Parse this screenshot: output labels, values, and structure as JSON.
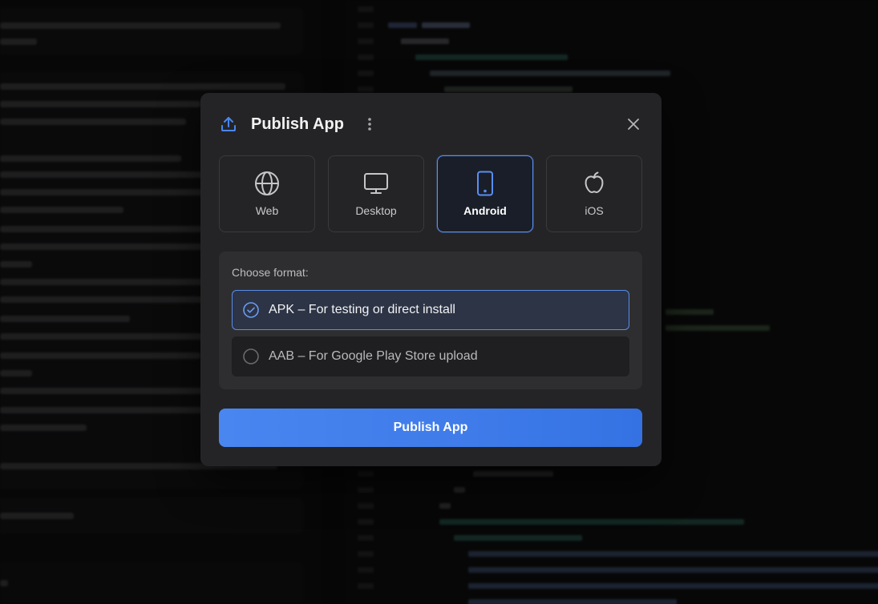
{
  "modal": {
    "title": "Publish App",
    "icons": {
      "upload": "upload-icon",
      "more": "more-vertical-icon",
      "close": "close-icon"
    },
    "platforms": [
      {
        "label": "Web",
        "icon": "globe-icon",
        "selected": false
      },
      {
        "label": "Desktop",
        "icon": "monitor-icon",
        "selected": false
      },
      {
        "label": "Android",
        "icon": "smartphone-icon",
        "selected": true
      },
      {
        "label": "iOS",
        "icon": "apple-icon",
        "selected": false
      }
    ],
    "format": {
      "title": "Choose format:",
      "options": [
        {
          "label": "APK – For testing or direct install",
          "selected": true
        },
        {
          "label": "AAB – For Google Play Store upload",
          "selected": false
        }
      ]
    },
    "publish_label": "Publish App"
  },
  "colors": {
    "accent": "#4a86f0",
    "modal_bg": "#242426",
    "panel_bg": "#2e2e31"
  }
}
